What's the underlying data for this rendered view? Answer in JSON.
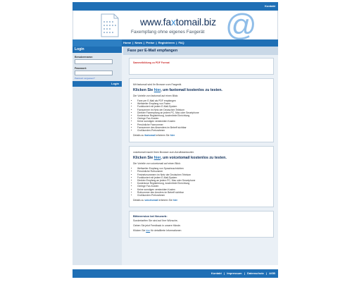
{
  "topbar": {
    "kontakt": "Kontakt"
  },
  "header": {
    "logo_part1": "www.fa",
    "logo_x": "x",
    "logo_part2": "tomail.biz",
    "tagline": "Faxempfang ohne eigenes Faxgerät",
    "at_symbol": "@"
  },
  "nav": {
    "items": [
      "Home",
      "News",
      "Preise",
      "Registrieren",
      "FAQ"
    ],
    "separator": "|"
  },
  "sidebar": {
    "title": "Login",
    "username_label": "Benutzername:",
    "password_label": "Passwort:",
    "forgot": "Passwort vergessen?",
    "login_button": "Login"
  },
  "main": {
    "title": "Faxe per E-Mail empfangen",
    "notice": "Sammelbildung zu PDF Format",
    "section1": {
      "intro": "Mit faxtomail wird Ihr Browser zum Faxgerät.",
      "headline_pre": "Klicken Sie ",
      "headline_link": "hier",
      "headline_post": ", um faxtomail kostenlos zu testen.",
      "lead": "Die Vorteile von faxtomail auf einen Blick:",
      "bullets": [
        "Faxe per E-Mail als PDF empfangen",
        "Weltweiter Empfang von Faxen",
        "Funktioniert mit jedem E-Mail-System",
        "Faxnummer im Netz der Deutschen Telekom",
        "Direkter Faxempfang an jedem PC, Mac oder Smartphone",
        "Kostenlose Registrierung, kostenfreie Einrichtung",
        "Geringe Fax-Kosten",
        "Keine sonstigen versteckten Kosten",
        "Persönliche Faxnummer",
        "Faxnummer des Absenders im Betreff sichtbar",
        "Großkunden-Preisrahmen"
      ],
      "details_pre": "Details zu ",
      "details_link": "faxtomail",
      "details_mid": " erfahren Sie ",
      "details_here": "hier"
    },
    "section2": {
      "intro": "voicetomail macht Ihren Browser zum Anrufbeantworter.",
      "headline_pre": "Klicken Sie ",
      "headline_link": "hier",
      "headline_post": ", um voicetomail kostenlos zu testen.",
      "lead": "Die Vorteile von voicetomail auf einen Blick:",
      "bullets": [
        "Weltweiter Empfang von Sprachnachrichten",
        "Persönliche Rufnummer",
        "Festnetznummern im Netz der Deutschen Telekom",
        "Funktioniert mit jedem E-Mail-System",
        "Direkter Empfang an jedem PC, Mac oder Smartphone",
        "Kostenlose Registrierung, kostenfreie Einrichtung",
        "Geringe Fax-Kosten",
        "Keine sonstigen versteckten Kosten",
        "Rufnummer des Anrufers im Betreff sichtbar",
        "Großkunden-Preisrahmen"
      ],
      "details_pre": "Details zu ",
      "details_link": "voicetomail",
      "details_mid": " erfahren Sie ",
      "details_here": "hier"
    },
    "section3": {
      "title": "Bitteversion bei Neuvorb:",
      "line1": "Sondertarifen Sie sind auf Ihre Wünsche,",
      "line2": "Geben Sie jetzt Feedback in unsere Hände.",
      "line3_pre": "Klicken Sie ",
      "line3_link": "hier",
      "line3_post": " für detaillierte Informationen"
    }
  },
  "footer": {
    "links": [
      "Kontakt",
      "Impressum",
      "Datenschutz",
      "AGB"
    ],
    "separator": "|"
  },
  "colors": {
    "primary": "#1f6fb5",
    "panel": "#eaf0f6",
    "accent": "#3a8fd6"
  }
}
